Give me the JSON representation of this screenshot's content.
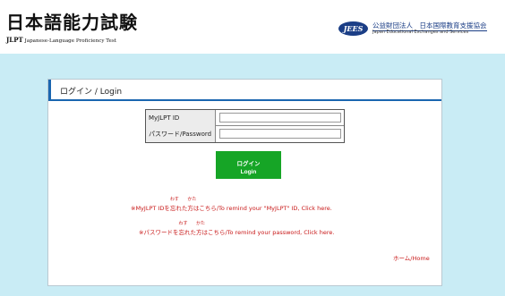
{
  "header": {
    "logo_title": "日本語能力試験",
    "logo_sub_jlpt": "JLPT",
    "logo_sub_text": "Japanese-Language Proficiency Test",
    "org_badge": "JEES",
    "org_name_jp": "公益財団法人　日本国際教育支援協会",
    "org_name_en": "Japan Educational Exchanges and Services"
  },
  "panel": {
    "title": "ログイン / Login"
  },
  "form": {
    "id_label": "MyJLPT ID",
    "id_value": "",
    "password_label": "パスワード/Password",
    "password_value": ""
  },
  "login_button": {
    "line1": "ログイン",
    "line2": "Login"
  },
  "remind_id": {
    "prefix": "※MyJLPT IDを",
    "kanji1": "忘",
    "ruby1": "わす",
    "mid": "れた",
    "kanji2": "方",
    "ruby2": "かた",
    "suffix": "はこちら/To remind your \"MyJLPT\" ID, Click here."
  },
  "remind_password": {
    "prefix": "※パスワードを",
    "kanji1": "忘",
    "ruby1": "わす",
    "mid": "れた",
    "kanji2": "方",
    "ruby2": "かた",
    "suffix": "はこちら/To remind your password, Click here."
  },
  "home_link": "ホーム/Home",
  "colors": {
    "background_blue": "#c9ecf5",
    "brand_blue": "#1a66b0",
    "button_green": "#16a526",
    "link_red": "#c81818"
  }
}
